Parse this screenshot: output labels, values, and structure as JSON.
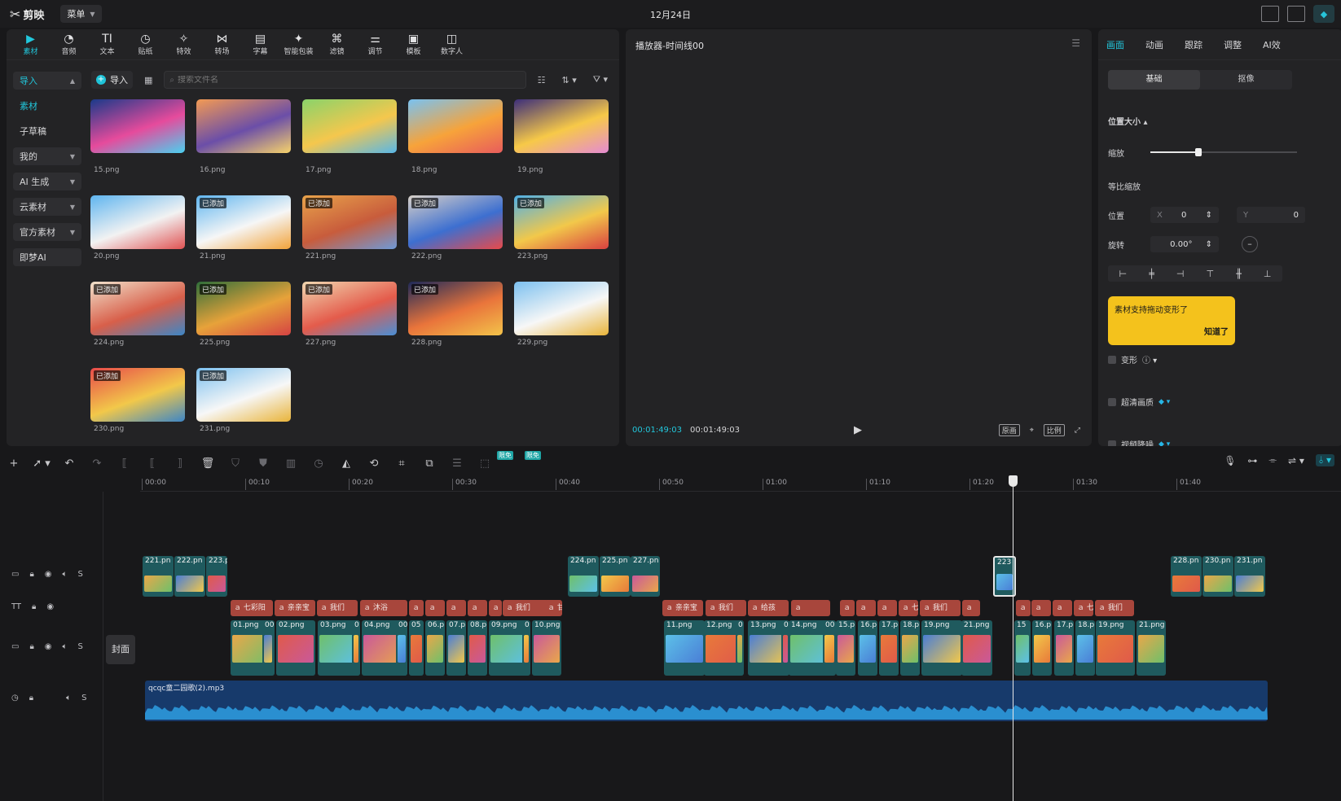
{
  "app": {
    "logo": "剪映",
    "menu_label": "菜单",
    "date": "12月24日"
  },
  "media_tabs": [
    {
      "label": "素材",
      "icon": "media-icon"
    },
    {
      "label": "音频",
      "icon": "audio-icon"
    },
    {
      "label": "文本",
      "icon": "text-icon"
    },
    {
      "label": "贴纸",
      "icon": "sticker-icon"
    },
    {
      "label": "特效",
      "icon": "effects-icon"
    },
    {
      "label": "转场",
      "icon": "transition-icon"
    },
    {
      "label": "字幕",
      "icon": "subtitle-icon"
    },
    {
      "label": "智能包装",
      "icon": "smart-package-icon"
    },
    {
      "label": "滤镜",
      "icon": "filter-icon"
    },
    {
      "label": "调节",
      "icon": "adjust-icon"
    },
    {
      "label": "模板",
      "icon": "template-icon"
    },
    {
      "label": "数字人",
      "icon": "digital-human-icon"
    }
  ],
  "sidebar": {
    "items": [
      "导入",
      "素材",
      "子草稿",
      "我的",
      "AI 生成",
      "云素材",
      "官方素材",
      "即梦AI"
    ]
  },
  "media": {
    "import_label": "导入",
    "search_placeholder": "搜索文件名",
    "all_label": "全部",
    "added_badge": "已添加",
    "items": [
      {
        "name": "15.png",
        "added": false
      },
      {
        "name": "16.png",
        "added": false
      },
      {
        "name": "17.png",
        "added": false
      },
      {
        "name": "18.png",
        "added": false
      },
      {
        "name": "19.png",
        "added": false
      },
      {
        "name": "20.png",
        "added": false
      },
      {
        "name": "21.png",
        "added": true
      },
      {
        "name": "221.png",
        "added": true
      },
      {
        "name": "222.png",
        "added": true
      },
      {
        "name": "223.png",
        "added": true
      },
      {
        "name": "224.png",
        "added": true
      },
      {
        "name": "225.png",
        "added": true
      },
      {
        "name": "227.png",
        "added": true
      },
      {
        "name": "228.png",
        "added": true
      },
      {
        "name": "229.png",
        "added": false
      },
      {
        "name": "230.png",
        "added": true
      },
      {
        "name": "231.png",
        "added": true
      }
    ]
  },
  "player": {
    "title": "播放器-时间线00",
    "current_time": "00:01:49:03",
    "total_time": "00:01:49:03",
    "btn_original": "原画",
    "btn_ratio": "比例"
  },
  "properties": {
    "tabs": [
      "画面",
      "动画",
      "跟踪",
      "调整",
      "AI效"
    ],
    "seg": [
      "基础",
      "抠像"
    ],
    "section": "位置大小",
    "scale_label": "缩放",
    "scale_value": 0.33,
    "uniform_label": "等比缩放",
    "position_label": "位置",
    "x_label": "X",
    "x_value": "0",
    "y_label": "Y",
    "y_value": "0",
    "rotate_label": "旋转",
    "rotate_value": "0.00°",
    "tooltip_text": "素材支持拖动变形了",
    "tooltip_ok": "知道了",
    "deform_label": "变形",
    "hd_label": "超清画质",
    "denoise_label": "视频降噪"
  },
  "timeline": {
    "limited_free": "限免",
    "ruler": [
      "00:00",
      "00:10",
      "00:20",
      "00:30",
      "00:40",
      "00:50",
      "01:00",
      "01:10",
      "01:20",
      "01:30",
      "01:40"
    ],
    "cover_label": "封面",
    "overlay_clips": [
      "221.pn",
      "222.pn",
      "223.p",
      "224.pn",
      "225.pn",
      "227.pn",
      "223",
      "228.pn",
      "230.pn",
      "231.pn"
    ],
    "text_clips": [
      "七彩阳",
      "亲亲宝",
      "我们",
      "沐浴",
      "",
      "",
      "",
      "",
      "七彩天",
      "我们",
      "甘甜雨",
      "亲亲宝",
      "我们",
      "给孩",
      "",
      "",
      "",
      "",
      "七彩天",
      "我们",
      "",
      "",
      "",
      "",
      "七彩天",
      "我们"
    ],
    "main_clips": [
      "01.png",
      "00",
      "02.png",
      "03.png",
      "0",
      "04.png",
      "00",
      "05",
      "06.p",
      "07.p",
      "08.p",
      "09.png",
      "0",
      "10.png",
      "11.png",
      "12.png",
      "0",
      "13.png",
      "0",
      "14.png",
      "00",
      "15.p",
      "16.p",
      "17.p",
      "18.p",
      "19.png",
      "21.png",
      "15",
      "16.p",
      "17.p",
      "18.p",
      "19.png",
      "21.png"
    ],
    "audio_label": "qcqc童二园歌(2).mp3"
  },
  "colors": {
    "accent": "#22c7dc",
    "text_clip": "#a8463c",
    "audio": "#173a6b",
    "tooltip": "#f4c21c"
  }
}
